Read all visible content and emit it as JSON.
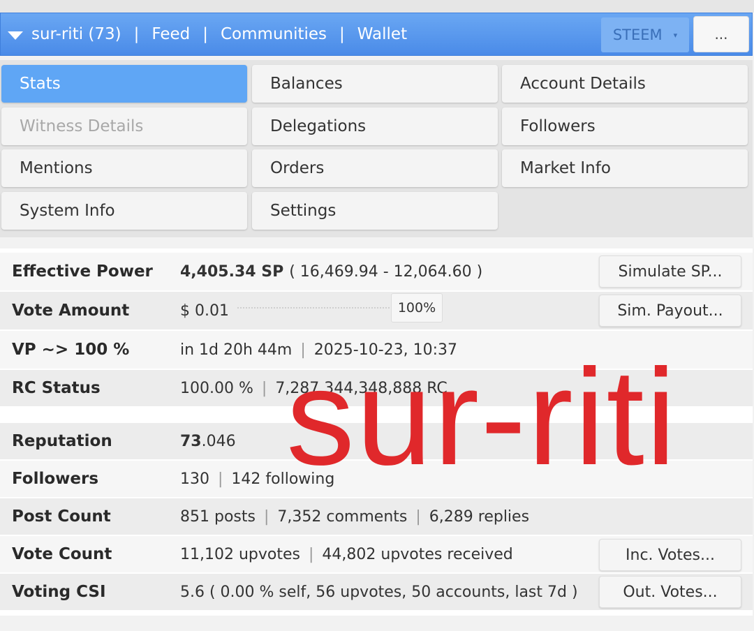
{
  "nav": {
    "account": "sur-riti (73)",
    "sep": "|",
    "links": [
      "Feed",
      "Communities",
      "Wallet"
    ],
    "currency": "STEEM",
    "currency_caret": "▾",
    "more": "..."
  },
  "tabs": [
    {
      "label": "Stats",
      "state": "active"
    },
    {
      "label": "Balances",
      "state": "normal"
    },
    {
      "label": "Account Details",
      "state": "normal"
    },
    {
      "label": "Witness Details",
      "state": "disabled"
    },
    {
      "label": "Delegations",
      "state": "normal"
    },
    {
      "label": "Followers",
      "state": "normal"
    },
    {
      "label": "Mentions",
      "state": "normal"
    },
    {
      "label": "Orders",
      "state": "normal"
    },
    {
      "label": "Market Info",
      "state": "normal"
    },
    {
      "label": "System Info",
      "state": "normal"
    },
    {
      "label": "Settings",
      "state": "normal"
    }
  ],
  "stats": {
    "effective_power": {
      "label": "Effective Power",
      "sp": "4,405.34 SP",
      "detail": "( 16,469.94 - 12,064.60 )",
      "button": "Simulate SP..."
    },
    "vote_amount": {
      "label": "Vote Amount",
      "value": "$ 0.01",
      "percent": "100%",
      "button": "Sim. Payout..."
    },
    "vp": {
      "label": "VP ~> 100 %",
      "eta": "in 1d 20h 44m",
      "date": "2025-10-23, 10:37"
    },
    "rc": {
      "label": "RC Status",
      "percent": "100.00 %",
      "amount": "7,287,344,348,888 RC"
    },
    "reputation": {
      "label": "Reputation",
      "int": "73",
      "frac": ".046"
    },
    "followers": {
      "label": "Followers",
      "followers": "130",
      "following": "142 following"
    },
    "post_count": {
      "label": "Post Count",
      "posts": "851 posts",
      "comments": "7,352 comments",
      "replies": "6,289 replies"
    },
    "vote_count": {
      "label": "Vote Count",
      "upvotes": "11,102 upvotes",
      "received": "44,802 upvotes received",
      "button": "Inc. Votes..."
    },
    "voting_csi": {
      "label": "Voting CSI",
      "value": "5.6 ( 0.00 % self, 56 upvotes, 50 accounts, last 7d )",
      "button": "Out. Votes..."
    }
  },
  "watermark": "sur-riti",
  "colors": {
    "nav_blue": "#4a8be8",
    "active_tab": "#5fa6f5",
    "watermark_red": "#e0282b"
  }
}
